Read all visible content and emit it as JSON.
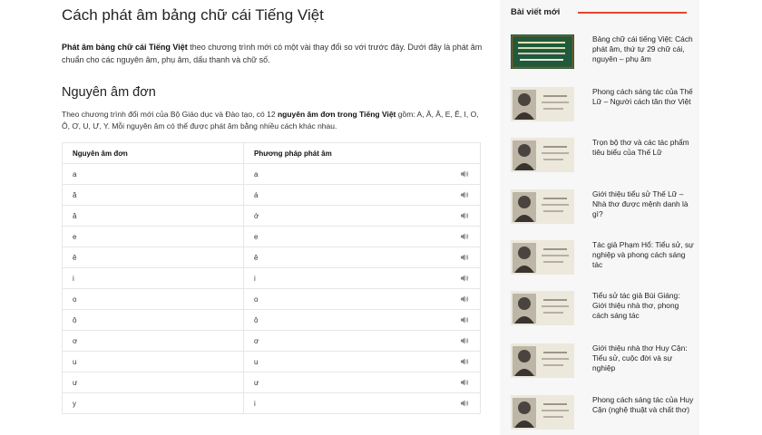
{
  "article": {
    "title": "Cách phát âm bảng chữ cái Tiếng Việt",
    "intro_bold": "Phát âm bảng chữ cái Tiếng Việt",
    "intro_rest": " theo chương trình mới có một vài thay đổi so với trước đây. Dưới đây là phát âm chuẩn cho các nguyên âm, phụ âm, dấu thanh và chữ số.",
    "section_title": "Nguyên âm đơn",
    "section_pre": "Theo chương trình đổi mới của Bộ Giáo dục và Đào tạo, có 12 ",
    "section_bold": "nguyên âm đơn trong Tiếng Việt",
    "section_post": " gồm: A, Ă, Â, E, Ê, I, O, Ô, Ơ, U, Ư, Y. Mỗi nguyên âm có thể được phát âm bằng nhiều cách khác nhau.",
    "table": {
      "headers": [
        "Nguyên âm đơn",
        "Phương pháp phát âm"
      ],
      "rows": [
        [
          "a",
          "a"
        ],
        [
          "ă",
          "á"
        ],
        [
          "â",
          "ớ"
        ],
        [
          "e",
          "e"
        ],
        [
          "ê",
          "ê"
        ],
        [
          "i",
          "i"
        ],
        [
          "o",
          "o"
        ],
        [
          "ô",
          "ô"
        ],
        [
          "ơ",
          "ơ"
        ],
        [
          "u",
          "u"
        ],
        [
          "ư",
          "ư"
        ],
        [
          "y",
          "i"
        ]
      ]
    }
  },
  "sidebar": {
    "title": "Bài viết mới",
    "accent_color": "#e8442e",
    "posts": [
      {
        "title": "Bảng chữ cái tiếng Việt: Cách phát âm, thứ tự 29 chữ cái, nguyên – phụ âm",
        "icon": "alphabet-board-thumbnail"
      },
      {
        "title": "Phong cách sáng tác của Thế Lữ – Người cách tân thơ Việt",
        "icon": "portrait-thumbnail"
      },
      {
        "title": "Trọn bộ thơ và các tác phẩm tiêu biểu của Thế Lữ",
        "icon": "portrait-thumbnail"
      },
      {
        "title": "Giới thiệu tiểu sử Thế Lữ – Nhà thơ được mệnh danh là gì?",
        "icon": "portrait-thumbnail"
      },
      {
        "title": "Tác giả Phạm Hổ: Tiểu sử, sự nghiệp và phong cách sáng tác",
        "icon": "portrait-thumbnail"
      },
      {
        "title": "Tiểu sử tác giả Bùi Giáng: Giới thiệu nhà thơ, phong cách sáng tác",
        "icon": "portrait-thumbnail"
      },
      {
        "title": "Giới thiệu nhà thơ Huy Cận: Tiểu sử, cuộc đời và sự nghiệp",
        "icon": "portrait-thumbnail"
      },
      {
        "title": "Phong cách sáng tác của Huy Cận (nghệ thuật và chất thơ)",
        "icon": "portrait-thumbnail"
      }
    ]
  }
}
